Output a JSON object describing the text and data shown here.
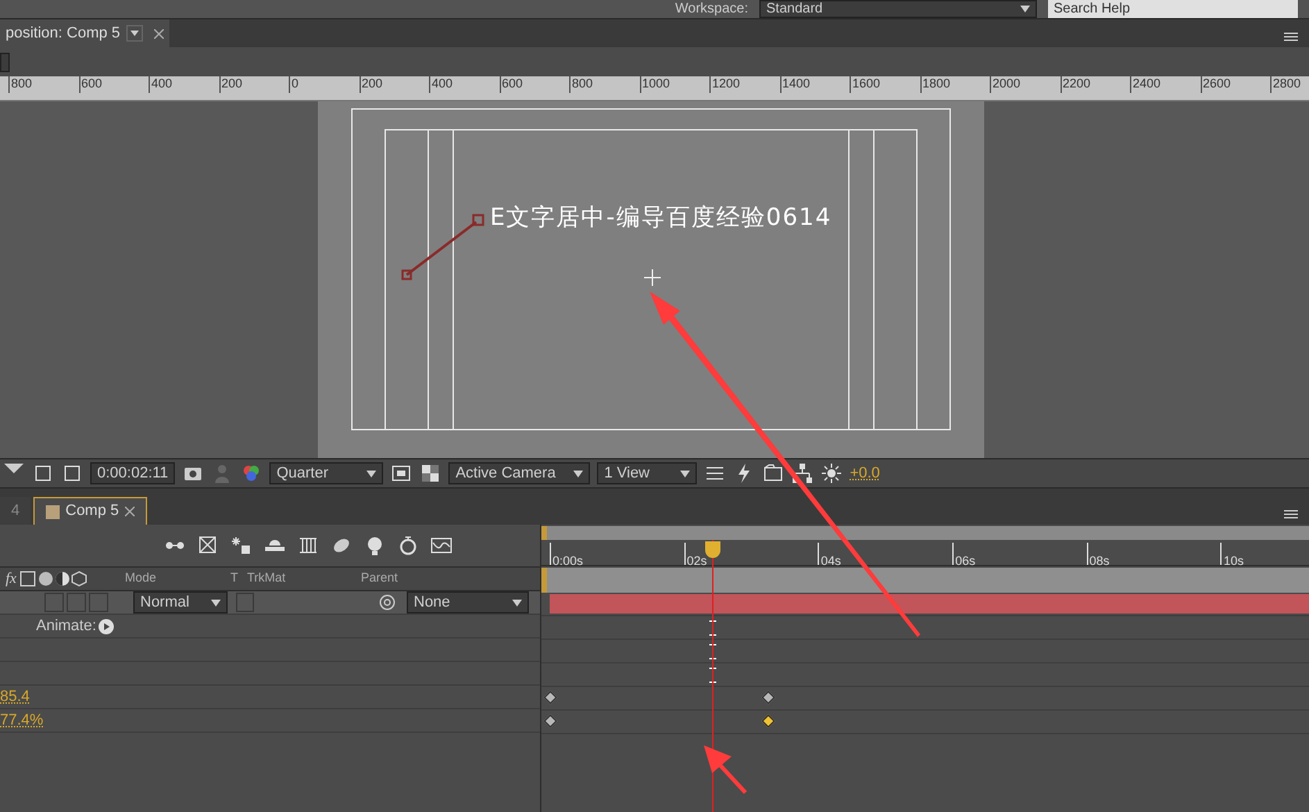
{
  "top_bar": {
    "workspace_label": "Workspace:",
    "workspace_value": "Standard",
    "search_placeholder": "Search Help"
  },
  "viewer": {
    "tab": {
      "label": "position: Comp 5",
      "selected": true
    },
    "ruler": [
      "800",
      "600",
      "400",
      "200",
      "0",
      "200",
      "400",
      "600",
      "800",
      "1000",
      "1200",
      "1400",
      "1600",
      "1800",
      "2000",
      "2200",
      "2400",
      "2600",
      "2800"
    ],
    "comp_text": "E文字居中-编导百度经验0614",
    "toolbar": {
      "timecode": "0:00:02:11",
      "resolution": "Quarter",
      "camera": "Active Camera",
      "views": "1 View",
      "exposure": "+0.0"
    }
  },
  "timeline": {
    "tabs": [
      {
        "label": "4",
        "selected": false
      },
      {
        "label": "Comp 5",
        "selected": true
      }
    ],
    "switches_label": "fx",
    "columns": [
      "Mode",
      "T",
      "TrkMat",
      "Parent"
    ],
    "layer": {
      "mode": "Normal",
      "parent": "None",
      "switches": [
        {
          "checked": false
        },
        {
          "checked": false
        },
        {
          "checked": false
        }
      ],
      "trkmat_checked": false
    },
    "time_ticks": [
      "0:00s",
      "02s",
      "04s",
      "06s",
      "08s",
      "10s"
    ],
    "rows": [
      {
        "kind": "animate",
        "label": "Animate:"
      },
      {
        "kind": "blank"
      },
      {
        "kind": "blank"
      },
      {
        "kind": "value",
        "label": "85.4",
        "keyframes": [
          {
            "selected": false
          },
          {
            "selected": false
          }
        ]
      },
      {
        "kind": "value",
        "label": "77.4%",
        "keyframes": [
          {
            "selected": false
          },
          {
            "selected": true
          }
        ]
      }
    ]
  }
}
